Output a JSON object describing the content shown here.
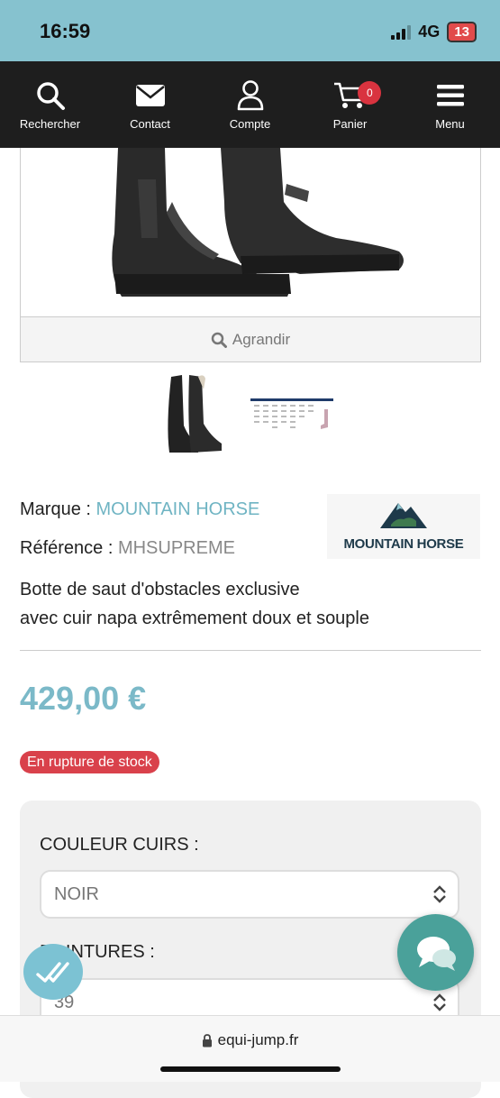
{
  "status": {
    "time": "16:59",
    "network": "4G",
    "battery": "13"
  },
  "nav": {
    "items": [
      {
        "label": "Rechercher",
        "icon": "search-icon"
      },
      {
        "label": "Contact",
        "icon": "envelope-icon"
      },
      {
        "label": "Compte",
        "icon": "user-icon"
      },
      {
        "label": "Panier",
        "icon": "cart-icon"
      },
      {
        "label": "Menu",
        "icon": "hamburger-icon"
      }
    ],
    "cart_count": "0"
  },
  "product": {
    "zoom_label": "Agrandir",
    "brand_label": "Marque :",
    "brand_value": "MOUNTAIN HORSE",
    "reference_label": "Référence :",
    "reference_value": "MHSUPREME",
    "brand_logo_text": "MOUNTAIN HORSE",
    "description_line1": "Botte de saut d'obstacles exclusive",
    "description_line2": "avec cuir napa extrêmement doux et souple",
    "price": "429,00 €",
    "stock_status": "En rupture de stock"
  },
  "options": {
    "color_label": "COULEUR CUIRS :",
    "color_value": "NOIR",
    "size_label": "POINTURES :",
    "size_value": "39"
  },
  "browser": {
    "url": "equi-jump.fr"
  },
  "colors": {
    "accent": "#7bb9c8",
    "navbar": "#1e1e1e",
    "status_bar": "#86c2cf",
    "stock_badge": "#d9414b",
    "chat": "#4aa19a"
  }
}
